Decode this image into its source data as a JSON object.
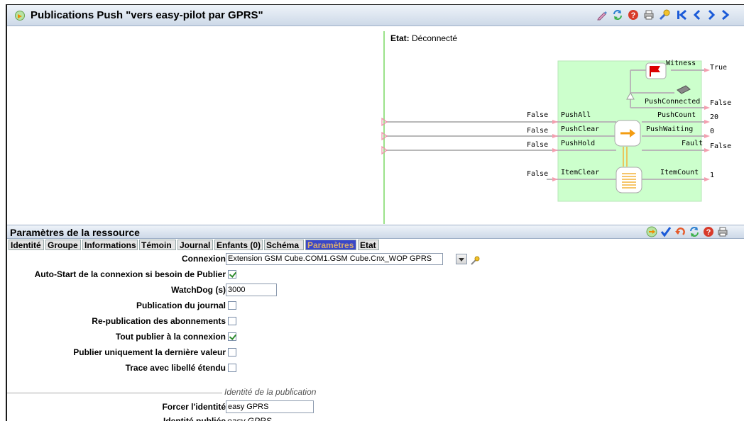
{
  "window": {
    "title": "Publications Push \"vers easy-pilot par GPRS\"",
    "toolbar_icons": [
      "edit-icon",
      "refresh-icon",
      "help-icon",
      "print-icon",
      "settings-icon",
      "first-icon",
      "prev-icon",
      "next-icon",
      "last-icon"
    ]
  },
  "diagram": {
    "etat_label": "Etat:",
    "etat_value": "Déconnecté",
    "inputs": [
      {
        "name": "PushAll",
        "value": "False"
      },
      {
        "name": "PushClear",
        "value": "False"
      },
      {
        "name": "PushHold",
        "value": "False"
      },
      {
        "name": "ItemClear",
        "value": "False"
      }
    ],
    "outputs": [
      {
        "name": "Witness",
        "value": "True"
      },
      {
        "name": "PushConnected",
        "value": "False"
      },
      {
        "name": "PushCount",
        "value": "20"
      },
      {
        "name": "PushWaiting",
        "value": "0"
      },
      {
        "name": "Fault",
        "value": "False"
      },
      {
        "name": "ItemCount",
        "value": "1"
      }
    ]
  },
  "panel": {
    "title": "Paramètres de la ressource",
    "tabs": [
      "Identité",
      "Groupe",
      "Informations",
      "Témoin",
      "Journal",
      "Enfants (0)",
      "Schéma",
      "Paramètres",
      "Etat"
    ],
    "active_tab": "Paramètres",
    "fields": {
      "connexion_label": "Connexion",
      "connexion_value": "Extension GSM Cube.COM1.GSM Cube.Cnx_WOP GPRS",
      "autostart_label": "Auto-Start de la connexion si besoin de Publier",
      "autostart_checked": true,
      "watchdog_label": "WatchDog (s)",
      "watchdog_value": "3000",
      "pubjournal_label": "Publication du journal",
      "pubjournal_checked": false,
      "repub_label": "Re-publication des abonnements",
      "repub_checked": false,
      "toutpublier_label": "Tout publier à la connexion",
      "toutpublier_checked": true,
      "derniere_label": "Publier uniquement la dernière valeur",
      "derniere_checked": false,
      "trace_label": "Trace avec libellé étendu",
      "trace_checked": false,
      "section_title": "Identité de la publication",
      "forcer_label": "Forcer l'identité",
      "forcer_value": "easy GPRS",
      "publiee_label": "Identité publiée",
      "publiee_value": "easy GPRS"
    }
  },
  "colors": {
    "block_bg": "#ccffcc",
    "wire": "#b0b0b0",
    "arrow_pink": "#f4a0b0",
    "accent_orange": "#f39c12",
    "active_tab_bg": "#3a47c8"
  }
}
